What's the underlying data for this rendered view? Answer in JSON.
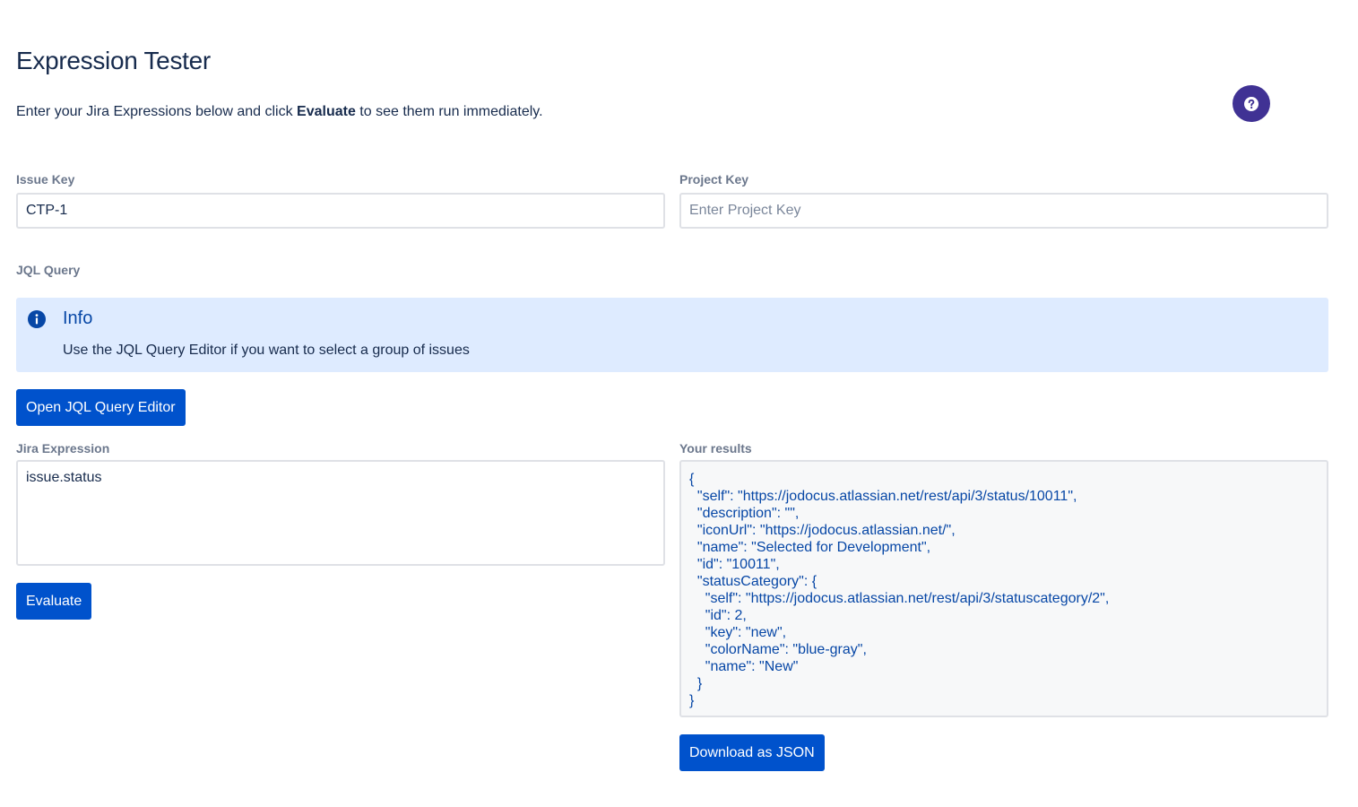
{
  "page": {
    "title": "Expression Tester",
    "intro_prefix": "Enter your Jira Expressions below and click ",
    "intro_bold": "Evaluate",
    "intro_suffix": " to see them run immediately."
  },
  "help": {
    "icon": "question-circle-icon",
    "color": "#403294"
  },
  "issue_key": {
    "label": "Issue Key",
    "value": "CTP-1",
    "placeholder": ""
  },
  "project_key": {
    "label": "Project Key",
    "value": "",
    "placeholder": "Enter Project Key"
  },
  "jql": {
    "label": "JQL Query",
    "info": {
      "icon": "info-icon",
      "title": "Info",
      "text": "Use the JQL Query Editor if you want to select a group of issues",
      "background": "#deebff"
    },
    "open_button": "Open JQL Query Editor"
  },
  "expression": {
    "label": "Jira Expression",
    "value": "issue.status",
    "evaluate_button": "Evaluate"
  },
  "results": {
    "label": "Your results",
    "lines": [
      "{",
      "  \"self\": \"https://jodocus.atlassian.net/rest/api/3/status/10011\",",
      "  \"description\": \"\",",
      "  \"iconUrl\": \"https://jodocus.atlassian.net/\",",
      "  \"name\": \"Selected for Development\",",
      "  \"id\": \"10011\",",
      "  \"statusCategory\": {",
      "    \"self\": \"https://jodocus.atlassian.net/rest/api/3/statuscategory/2\",",
      "    \"id\": 2,",
      "    \"key\": \"new\",",
      "    \"colorName\": \"blue-gray\",",
      "    \"name\": \"New\"",
      "  }",
      "}"
    ],
    "download_button": "Download as JSON"
  },
  "colors": {
    "primary": "#0052cc",
    "text": "#172b4d",
    "label": "#6b778c",
    "results_text": "#0747a6"
  }
}
